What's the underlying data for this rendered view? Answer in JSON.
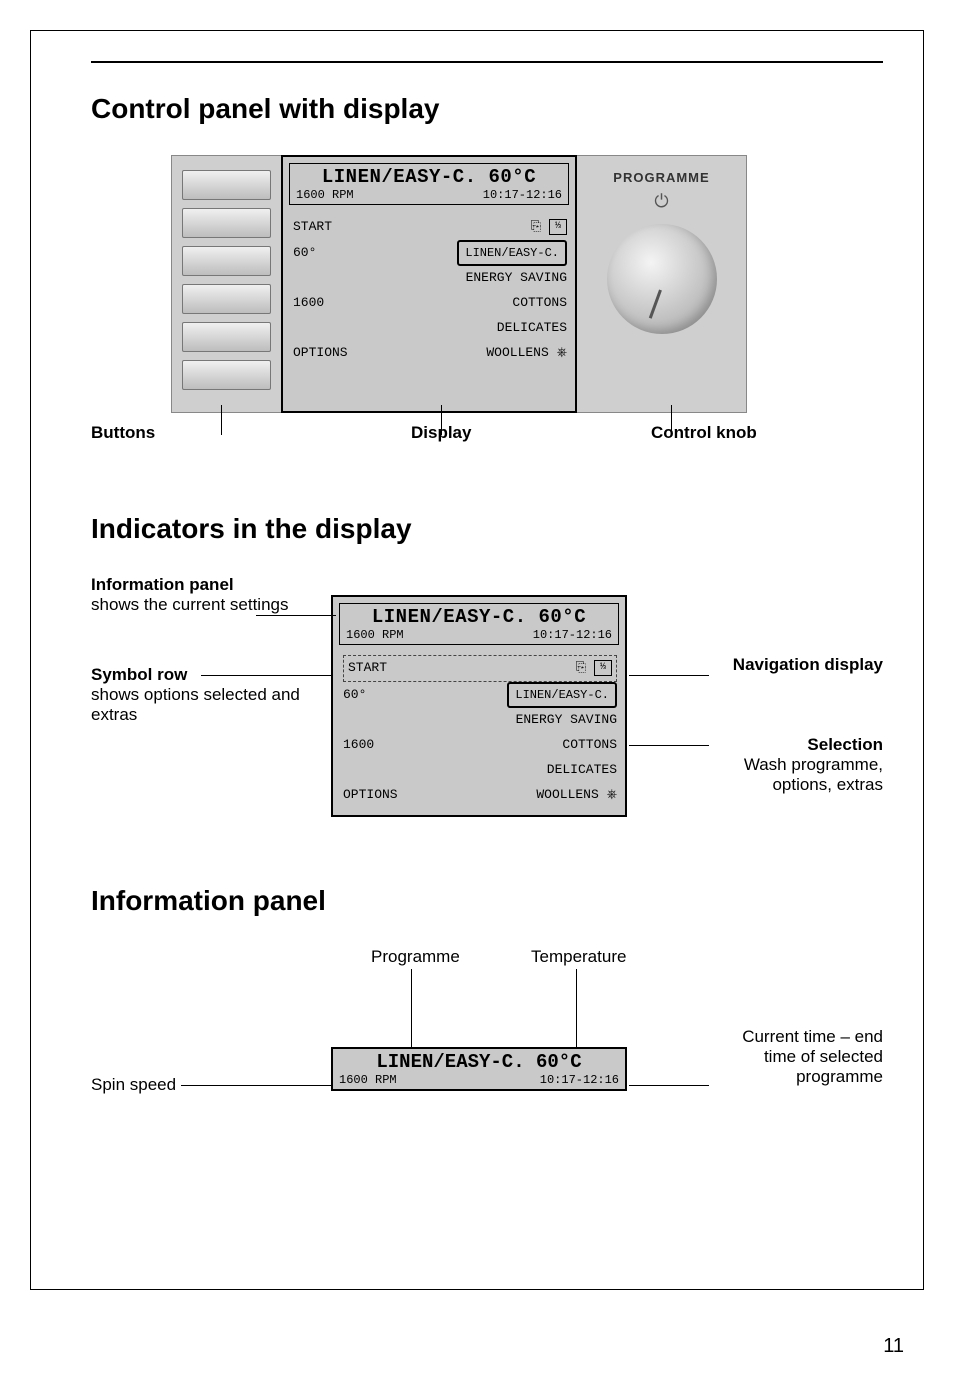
{
  "page_number": "11",
  "section1": {
    "title": "Control panel with display",
    "labels": {
      "buttons": "Buttons",
      "display": "Display",
      "control_knob": "Control knob"
    },
    "knob_title": "PROGRAMME"
  },
  "display": {
    "info_title": "LINEN/EASY-C. 60°C",
    "rpm": "1600 RPM",
    "time": "10:17-12:16",
    "rows_left": [
      "START",
      "60°",
      "1600",
      "OPTIONS"
    ],
    "rows_right_plain": [
      "ENERGY SAVING",
      "COTTONS",
      "DELICATES",
      "WOOLLENS"
    ],
    "selected_program": "LINEN/EASY-C.",
    "icon1": "⎘",
    "icon2": "⅓"
  },
  "section2": {
    "title": "Indicators in the display",
    "left1_b": "Information panel",
    "left1_t": "shows the current settings",
    "left2_b": "Symbol row",
    "left2_t": "shows options selected and extras",
    "right1_b": "Navigation display",
    "right2_b": "Selection",
    "right2_t": "Wash programme, options, extras"
  },
  "section3": {
    "title": "Information panel",
    "lab_programme": "Programme",
    "lab_temperature": "Temperature",
    "lab_spin": "Spin speed",
    "lab_time": "Current time – end time of selected programme"
  }
}
